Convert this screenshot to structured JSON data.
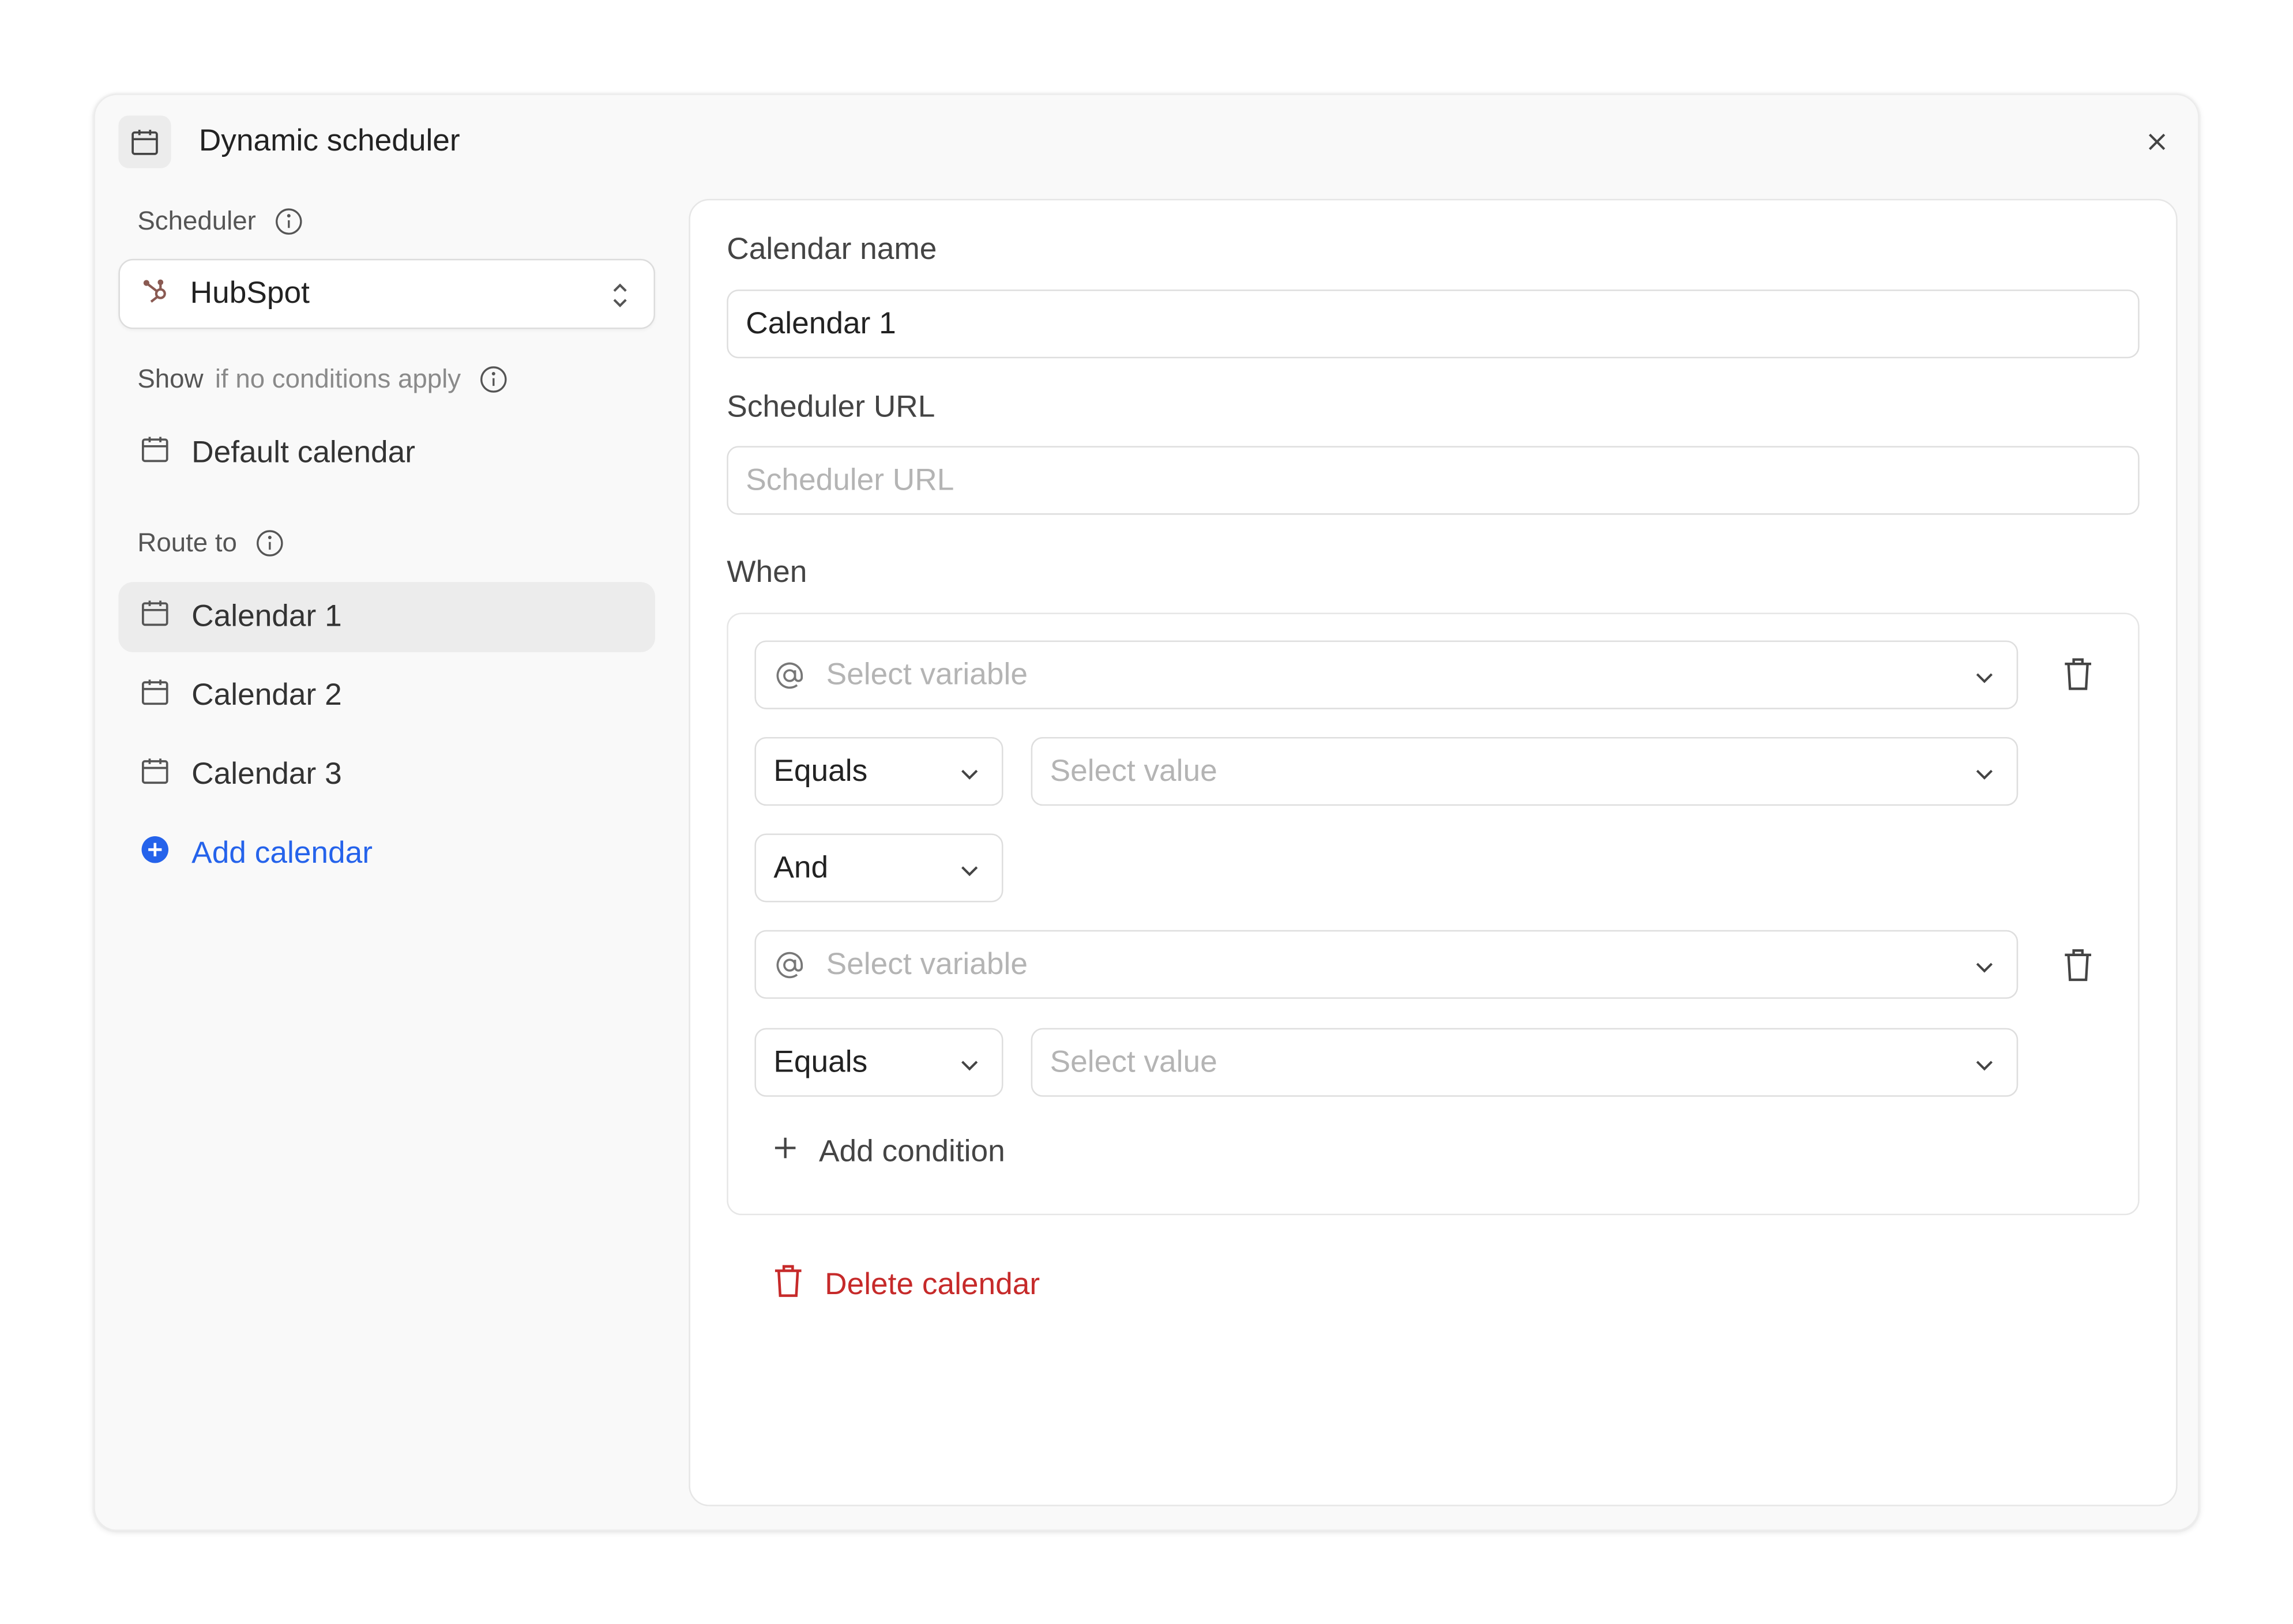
{
  "dialog": {
    "title": "Dynamic scheduler",
    "icon": "calendar-icon",
    "close_icon": "close-icon"
  },
  "sidebar": {
    "scheduler_label": "Scheduler",
    "scheduler_value": "HubSpot",
    "show_label": "Show",
    "show_hint": "if no conditions apply",
    "default_calendar": "Default calendar",
    "route_label": "Route to",
    "calendars": [
      {
        "label": "Calendar 1",
        "active": true
      },
      {
        "label": "Calendar 2",
        "active": false
      },
      {
        "label": "Calendar 3",
        "active": false
      }
    ],
    "add_calendar": "Add calendar"
  },
  "editor": {
    "calendar_name_label": "Calendar name",
    "calendar_name_value": "Calendar 1",
    "scheduler_url_label": "Scheduler URL",
    "scheduler_url_placeholder": "Scheduler URL",
    "when_label": "When",
    "conditions": [
      {
        "variable_placeholder": "Select variable",
        "operator": "Equals",
        "value_placeholder": "Select value"
      },
      {
        "variable_placeholder": "Select variable",
        "operator": "Equals",
        "value_placeholder": "Select value"
      }
    ],
    "connector": "And",
    "add_condition": "Add condition",
    "delete_calendar": "Delete calendar"
  },
  "colors": {
    "accent_blue": "#2563eb",
    "danger_red": "#c62a2a",
    "hubspot_icon": "#8a5a52"
  }
}
